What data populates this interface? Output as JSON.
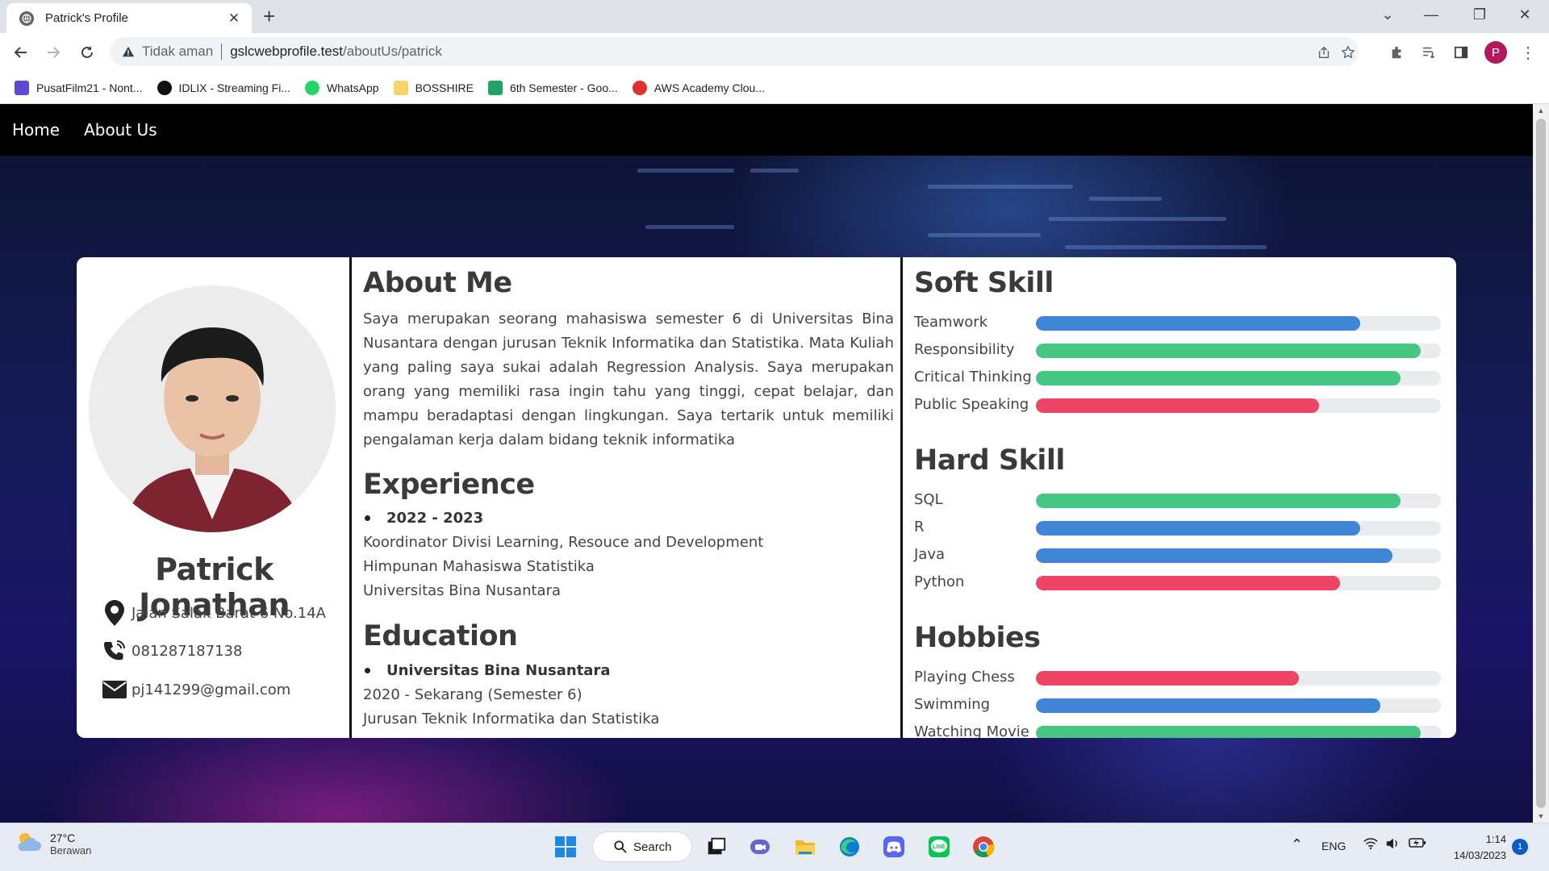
{
  "browser": {
    "tab_title": "Patrick's Profile",
    "address_status": "Tidak aman",
    "address_host": "gslcwebprofile.test",
    "address_path": "/aboutUs/patrick",
    "profile_initial": "P",
    "bookmarks": [
      {
        "label": "PusatFilm21 - Nont...",
        "icon": "film-icon",
        "color": "#5b4bd0"
      },
      {
        "label": "IDLIX - Streaming Fi...",
        "icon": "idlix-icon",
        "color": "#111111"
      },
      {
        "label": "WhatsApp",
        "icon": "whatsapp-icon",
        "color": "#25d366"
      },
      {
        "label": "BOSSHIRE",
        "icon": "folder-icon",
        "color": "#f5d46a"
      },
      {
        "label": "6th Semester - Goo...",
        "icon": "google-drive-icon",
        "color": "#1fa463"
      },
      {
        "label": "AWS Academy Clou...",
        "icon": "aws-icon",
        "color": "#e0312c"
      }
    ]
  },
  "nav": {
    "home": "Home",
    "about": "About Us"
  },
  "profile": {
    "name": "Patrick Jonathan",
    "address": "Jalan Salak Barat 6 No.14A",
    "phone": "081287187138",
    "email": "pj141299@gmail.com"
  },
  "about": {
    "heading": "About Me",
    "text": "Saya merupakan seorang mahasiswa semester 6 di Universitas Bina Nusantara dengan jurusan Teknik Informatika dan Statistika. Mata Kuliah yang paling saya sukai adalah Regression Analysis. Saya merupakan orang yang memiliki rasa ingin tahu yang tinggi, cepat belajar, dan mampu beradaptasi dengan lingkungan. Saya tertarik untuk memiliki pengalaman kerja dalam bidang teknik informatika"
  },
  "experience": {
    "heading": "Experience",
    "period": "2022 - 2023",
    "lines": [
      "Koordinator Divisi Learning, Resouce and Development",
      "Himpunan Mahasiswa Statistika",
      "Universitas Bina Nusantara"
    ]
  },
  "education": {
    "heading": "Education",
    "school": "Universitas Bina Nusantara",
    "lines": [
      "2020 - Sekarang (Semester 6)",
      "Jurusan Teknik Informatika dan Statistika"
    ]
  },
  "skills": [
    {
      "heading": "Soft Skill",
      "items": [
        {
          "label": "Teamwork",
          "level": 0.8,
          "color": "#3f86d6"
        },
        {
          "label": "Responsibility",
          "level": 0.95,
          "color": "#45c683"
        },
        {
          "label": "Critical Thinking",
          "level": 0.9,
          "color": "#45c683"
        },
        {
          "label": "Public Speaking",
          "level": 0.7,
          "color": "#ee4466"
        }
      ]
    },
    {
      "heading": "Hard Skill",
      "items": [
        {
          "label": "SQL",
          "level": 0.9,
          "color": "#45c683"
        },
        {
          "label": "R",
          "level": 0.8,
          "color": "#3f86d6"
        },
        {
          "label": "Java",
          "level": 0.88,
          "color": "#3f86d6"
        },
        {
          "label": "Python",
          "level": 0.75,
          "color": "#ee4466"
        }
      ]
    },
    {
      "heading": "Hobbies",
      "items": [
        {
          "label": "Playing Chess",
          "level": 0.65,
          "color": "#ee4466"
        },
        {
          "label": "Swimming",
          "level": 0.85,
          "color": "#3f86d6"
        },
        {
          "label": "Watching Movie",
          "level": 0.95,
          "color": "#45c683"
        }
      ]
    }
  ],
  "taskbar": {
    "temperature": "27°C",
    "condition": "Berawan",
    "search_label": "Search",
    "language": "ENG",
    "time": "1:14",
    "date": "14/03/2023",
    "notifications": "1"
  }
}
